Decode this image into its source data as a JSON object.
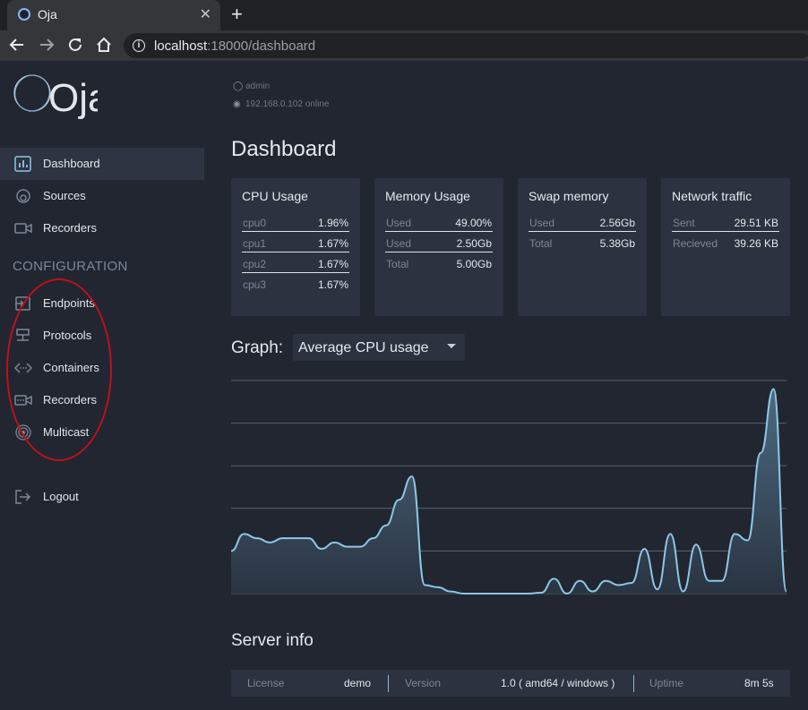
{
  "browser": {
    "tab_title": "Oja",
    "tab_close": "✕",
    "new_tab": "+",
    "url_host": "localhost",
    "url_rest": ":18000/dashboard"
  },
  "app": {
    "logo_text": "Oja",
    "user": {
      "name": "admin",
      "status": "192.168.0.102 online"
    }
  },
  "sidebar": {
    "items": [
      {
        "label": "Dashboard",
        "icon": "bar-chart-icon",
        "active": true
      },
      {
        "label": "Sources",
        "icon": "source-icon"
      },
      {
        "label": "Recorders",
        "icon": "camera-icon"
      }
    ],
    "config_title": "CONFIGURATION",
    "config_items": [
      {
        "label": "Endpoints",
        "icon": "endpoint-icon"
      },
      {
        "label": "Protocols",
        "icon": "network-icon"
      },
      {
        "label": "Containers",
        "icon": "code-icon"
      },
      {
        "label": "Recorders",
        "icon": "video-icon"
      },
      {
        "label": "Multicast",
        "icon": "broadcast-icon"
      }
    ],
    "logout": {
      "label": "Logout",
      "icon": "logout-icon"
    }
  },
  "main": {
    "title": "Dashboard",
    "cards": [
      {
        "title": "CPU Usage",
        "rows": [
          {
            "k": "cpu0",
            "v": "1.96%"
          },
          {
            "k": "cpu1",
            "v": "1.67%"
          },
          {
            "k": "cpu2",
            "v": "1.67%"
          },
          {
            "k": "cpu3",
            "v": "1.67%"
          }
        ]
      },
      {
        "title": "Memory Usage",
        "rows": [
          {
            "k": "Used",
            "v": "49.00%"
          },
          {
            "k": "Used",
            "v": "2.50Gb"
          },
          {
            "k": "Total",
            "v": "5.00Gb"
          }
        ]
      },
      {
        "title": "Swap memory",
        "rows": [
          {
            "k": "Used",
            "v": "2.56Gb"
          },
          {
            "k": "Total",
            "v": "5.38Gb"
          }
        ]
      },
      {
        "title": "Network traffic",
        "rows": [
          {
            "k": "Sent",
            "v": "29.51 KB"
          },
          {
            "k": "Recieved",
            "v": "39.26 KB"
          }
        ]
      }
    ],
    "graph_label": "Graph:",
    "graph_select": "Average CPU usage",
    "server_info": {
      "title": "Server info",
      "license_label": "License",
      "license_value": "demo",
      "version_label": "Version",
      "version_value": "1.0 ( amd64 / windows )",
      "uptime_label": "Uptime",
      "uptime_value": "8m 5s"
    }
  },
  "chart_data": {
    "type": "area",
    "grid": true,
    "ylim": [
      0,
      5
    ],
    "colors": {
      "line": "#8ec6e6",
      "fill_top": "#4c6a80",
      "fill_bottom": "#2a3442"
    },
    "values": [
      1.0,
      1.4,
      1.3,
      1.2,
      1.3,
      1.3,
      1.3,
      1.05,
      1.2,
      1.1,
      1.1,
      1.3,
      1.6,
      2.2,
      2.75,
      0.2,
      0.15,
      0.05,
      0.0,
      0.0,
      0.0,
      0.0,
      0.0,
      0.0,
      0.02,
      0.35,
      0.0,
      0.3,
      0.05,
      0.3,
      0.2,
      0.25,
      1.05,
      0.1,
      1.4,
      0.05,
      1.15,
      0.3,
      0.3,
      1.4,
      1.25,
      3.3,
      4.8,
      0.05
    ]
  }
}
